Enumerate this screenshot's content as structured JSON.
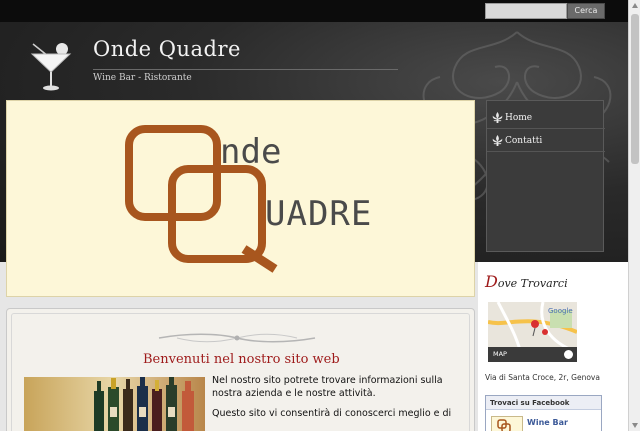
{
  "search": {
    "placeholder": "",
    "button_label": "Cerca"
  },
  "header": {
    "title": "Onde Quadre",
    "tagline": "Wine Bar - Ristorante"
  },
  "banner": {
    "logo_word_1": "nde",
    "logo_word_2": "UADRE",
    "logo_color": "#a8561e"
  },
  "nav": {
    "items": [
      {
        "label": "Home"
      },
      {
        "label": "Contatti"
      }
    ]
  },
  "main": {
    "welcome_title": "Benvenuti nel nostro sito web",
    "paragraph_1": "Nel nostro sito potrete trovare informazioni sulla nostra azienda e le nostre attività.",
    "paragraph_2": "Questo sito vi consentirà di conoscerci meglio e di"
  },
  "sidebar": {
    "dove_cap": "D",
    "dove_rest": "ove Trovarci",
    "map_label": "MAP",
    "map_brand": "Google",
    "address": "Via di Santa Croce, 2r, Genova",
    "facebook": {
      "header": "Trovaci su Facebook",
      "page_name": "Wine Bar"
    }
  },
  "colors": {
    "accent_red": "#9e1a1a",
    "header_dark": "#2a2a2a",
    "banner_bg": "#fdf7d8"
  }
}
